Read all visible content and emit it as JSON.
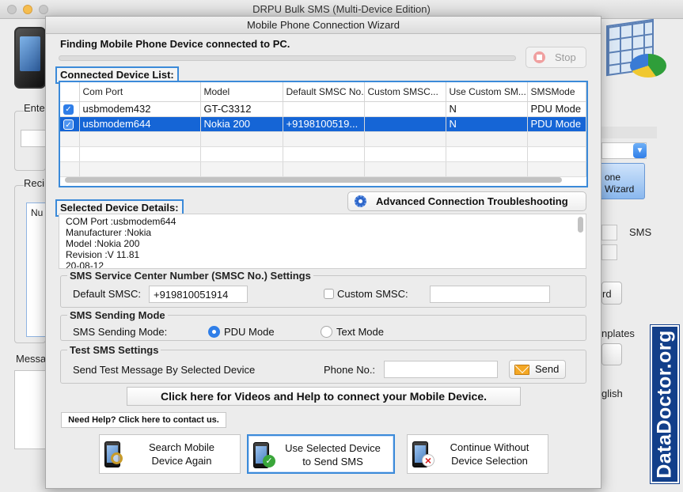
{
  "main_window": {
    "title": "DRPU Bulk SMS (Multi-Device Edition)",
    "bg_labels": {
      "enter": "Ente",
      "recipients": "Reci",
      "num": "Nu",
      "message": "Messa",
      "sms": "SMS",
      "wizard_line1": "one",
      "wizard_line2": "Wizard",
      "rd": "rd",
      "templates": "nplates",
      "english": "glish"
    },
    "brand": "DataDoctor.org"
  },
  "dialog": {
    "title": "Mobile Phone Connection Wizard",
    "finding_text": "Finding Mobile Phone Device connected to PC.",
    "stop_label": "Stop",
    "connected_list_label": "Connected Device List:",
    "table": {
      "columns": [
        "",
        "Com Port",
        "Model",
        "Default SMSC No.",
        "Custom SMSC...",
        "Use Custom SM...",
        "SMSMode"
      ],
      "rows": [
        {
          "checked": true,
          "com_port": "usbmodem432",
          "model": "GT-C3312",
          "default_smsc": "",
          "custom_smsc": "",
          "use_custom": "N",
          "mode": "PDU Mode"
        },
        {
          "checked": true,
          "com_port": "usbmodem644",
          "model": "Nokia 200",
          "default_smsc": "+9198100519...",
          "custom_smsc": "",
          "use_custom": "N",
          "mode": "PDU Mode"
        }
      ]
    },
    "advanced_label": "Advanced Connection Troubleshooting",
    "selected_details_label": "Selected Device Details:",
    "details_lines": [
      "COM Port :usbmodem644",
      "Manufacturer :Nokia",
      "Model :Nokia 200",
      "Revision :V 11.81",
      "20-08-12"
    ],
    "smsc_group": {
      "legend": "SMS Service Center Number (SMSC No.) Settings",
      "default_label": "Default SMSC:",
      "default_value": "+919810051914",
      "custom_label": "Custom SMSC:",
      "custom_value": ""
    },
    "mode_group": {
      "legend": "SMS Sending Mode",
      "label": "SMS Sending Mode:",
      "pdu": "PDU Mode",
      "text": "Text Mode"
    },
    "test_group": {
      "legend": "Test SMS Settings",
      "label": "Send Test Message By Selected Device",
      "phone_label": "Phone No.:",
      "phone_value": "",
      "send_label": "Send"
    },
    "videos_label": "Click here for Videos and Help to connect your Mobile Device.",
    "help_label": "Need Help? Click here to contact us.",
    "buttons": {
      "search_line1": "Search Mobile",
      "search_line2": "Device Again",
      "use_line1": "Use Selected Device",
      "use_line2": "to Send SMS",
      "continue_line1": "Continue Without",
      "continue_line2": "Device Selection"
    }
  }
}
